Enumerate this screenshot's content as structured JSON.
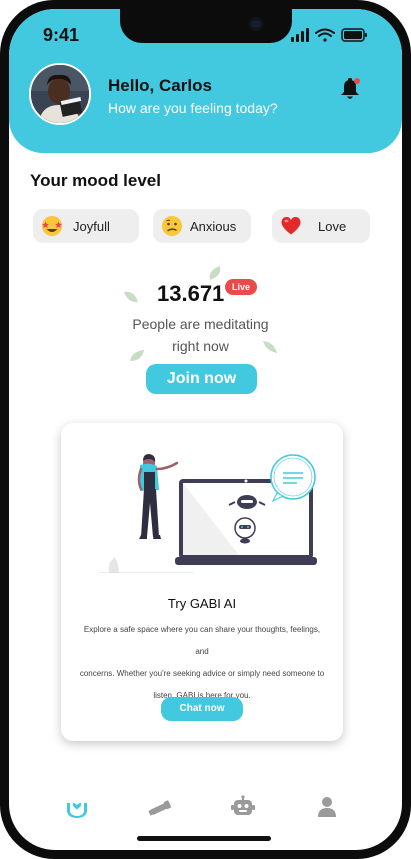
{
  "status_bar": {
    "time": "9:41"
  },
  "header": {
    "greeting": "Hello, Carlos",
    "subtitle": "How are you feeling today?",
    "notification_icon": "bell-icon"
  },
  "mood": {
    "title": "Your mood level",
    "options": [
      {
        "label": "Joyfull",
        "icon": "star-struck-emoji-icon"
      },
      {
        "label": "Anxious",
        "icon": "confused-emoji-icon"
      },
      {
        "label": "Love",
        "icon": "heart-icon"
      }
    ]
  },
  "meditation": {
    "count": "13.671",
    "live_label": "Live",
    "text_line1": "People are meditating",
    "text_line2": "right now",
    "join_label": "Join now"
  },
  "ai_card": {
    "title": "Try GABI AI",
    "desc_line1": "Explore a safe space where you can share your thoughts, feelings, and",
    "desc_line2": "concerns. Whether you're seeking advice or simply need someone to",
    "desc_line3": "listen,  GABI is here for you.",
    "button_label": "Chat now"
  },
  "bottom_nav": {
    "items": [
      {
        "icon": "care-hands-icon",
        "active": true
      },
      {
        "icon": "telescope-icon",
        "active": false
      },
      {
        "icon": "robot-icon",
        "active": false
      },
      {
        "icon": "profile-icon",
        "active": false
      }
    ]
  },
  "colors": {
    "accent": "#42c8df",
    "live_badge": "#e94b4b",
    "nav_inactive": "#9a9a9a"
  }
}
